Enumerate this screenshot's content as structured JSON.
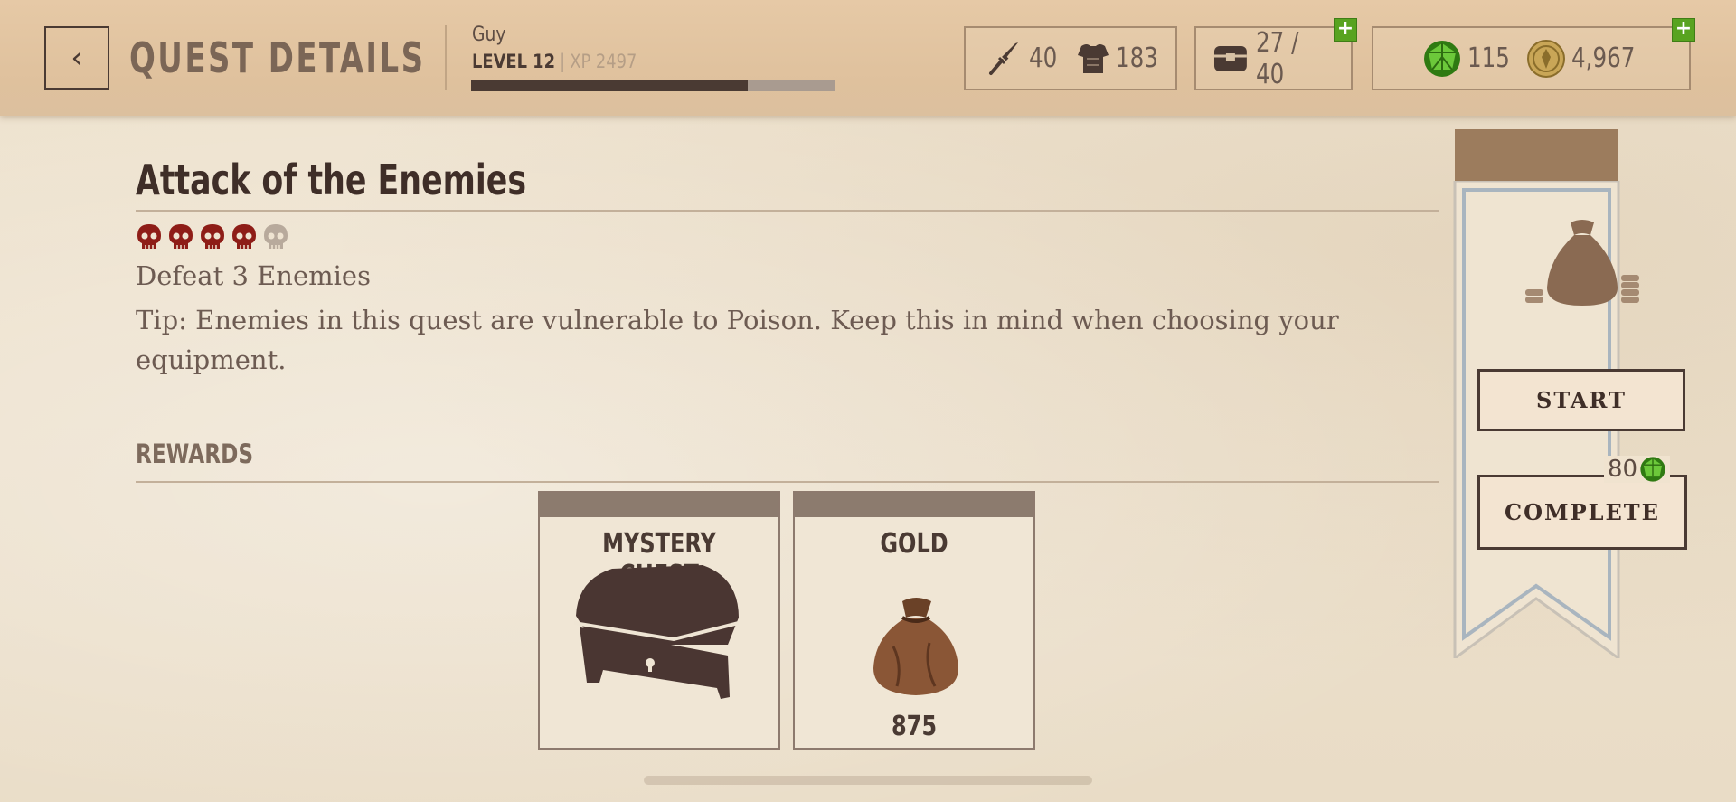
{
  "header": {
    "title": "QUEST DETAILS",
    "player_name": "Guy",
    "level": "LEVEL 12",
    "xp": "XP 2497",
    "xp_progress": 0.76,
    "attack": "40",
    "armor": "183",
    "inventory": "27 / 40",
    "gems": "115",
    "gold": "4,967"
  },
  "quest": {
    "title": "Attack of the Enemies",
    "difficulty_filled": 4,
    "difficulty_total": 5,
    "objective": "Defeat 3 Enemies",
    "tip": "Tip: Enemies in this quest are vulnerable to Poison. Keep this in mind when choosing your equipment."
  },
  "rewards": {
    "heading": "REWARDS",
    "items": [
      {
        "label": "MYSTERY CHEST"
      },
      {
        "label": "GOLD",
        "amount": "875"
      }
    ]
  },
  "actions": {
    "start_label": "START",
    "complete_label": "COMPLETE",
    "complete_cost": "80"
  },
  "colors": {
    "accent": "#4a3a33",
    "gem_green": "#3f9a1a",
    "skull_active": "#8e1d17",
    "skull_inactive": "#b8aa9c"
  }
}
